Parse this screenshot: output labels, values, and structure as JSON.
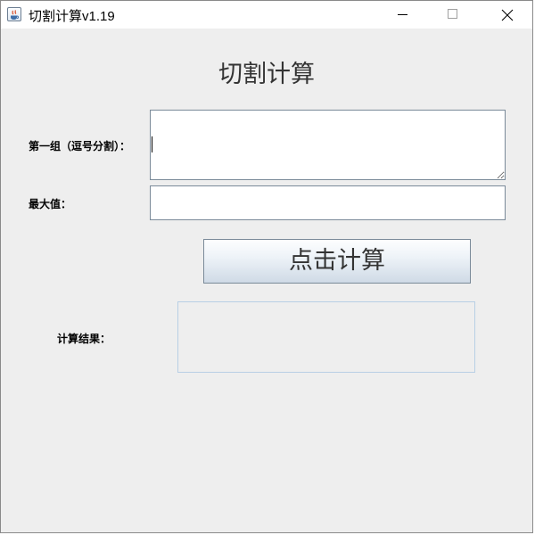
{
  "window": {
    "title": "切割计算v1.19"
  },
  "main": {
    "heading": "切割计算",
    "group_label": "第一组（逗号分割）：",
    "group_value": "",
    "max_label": "最大值：",
    "max_value": "",
    "calc_button_label": "点击计算",
    "result_label": "计算结果：",
    "result_value": ""
  },
  "icons": {
    "app": "java-app-icon",
    "minimize": "minimize-icon",
    "maximize": "maximize-icon",
    "close": "close-icon"
  }
}
